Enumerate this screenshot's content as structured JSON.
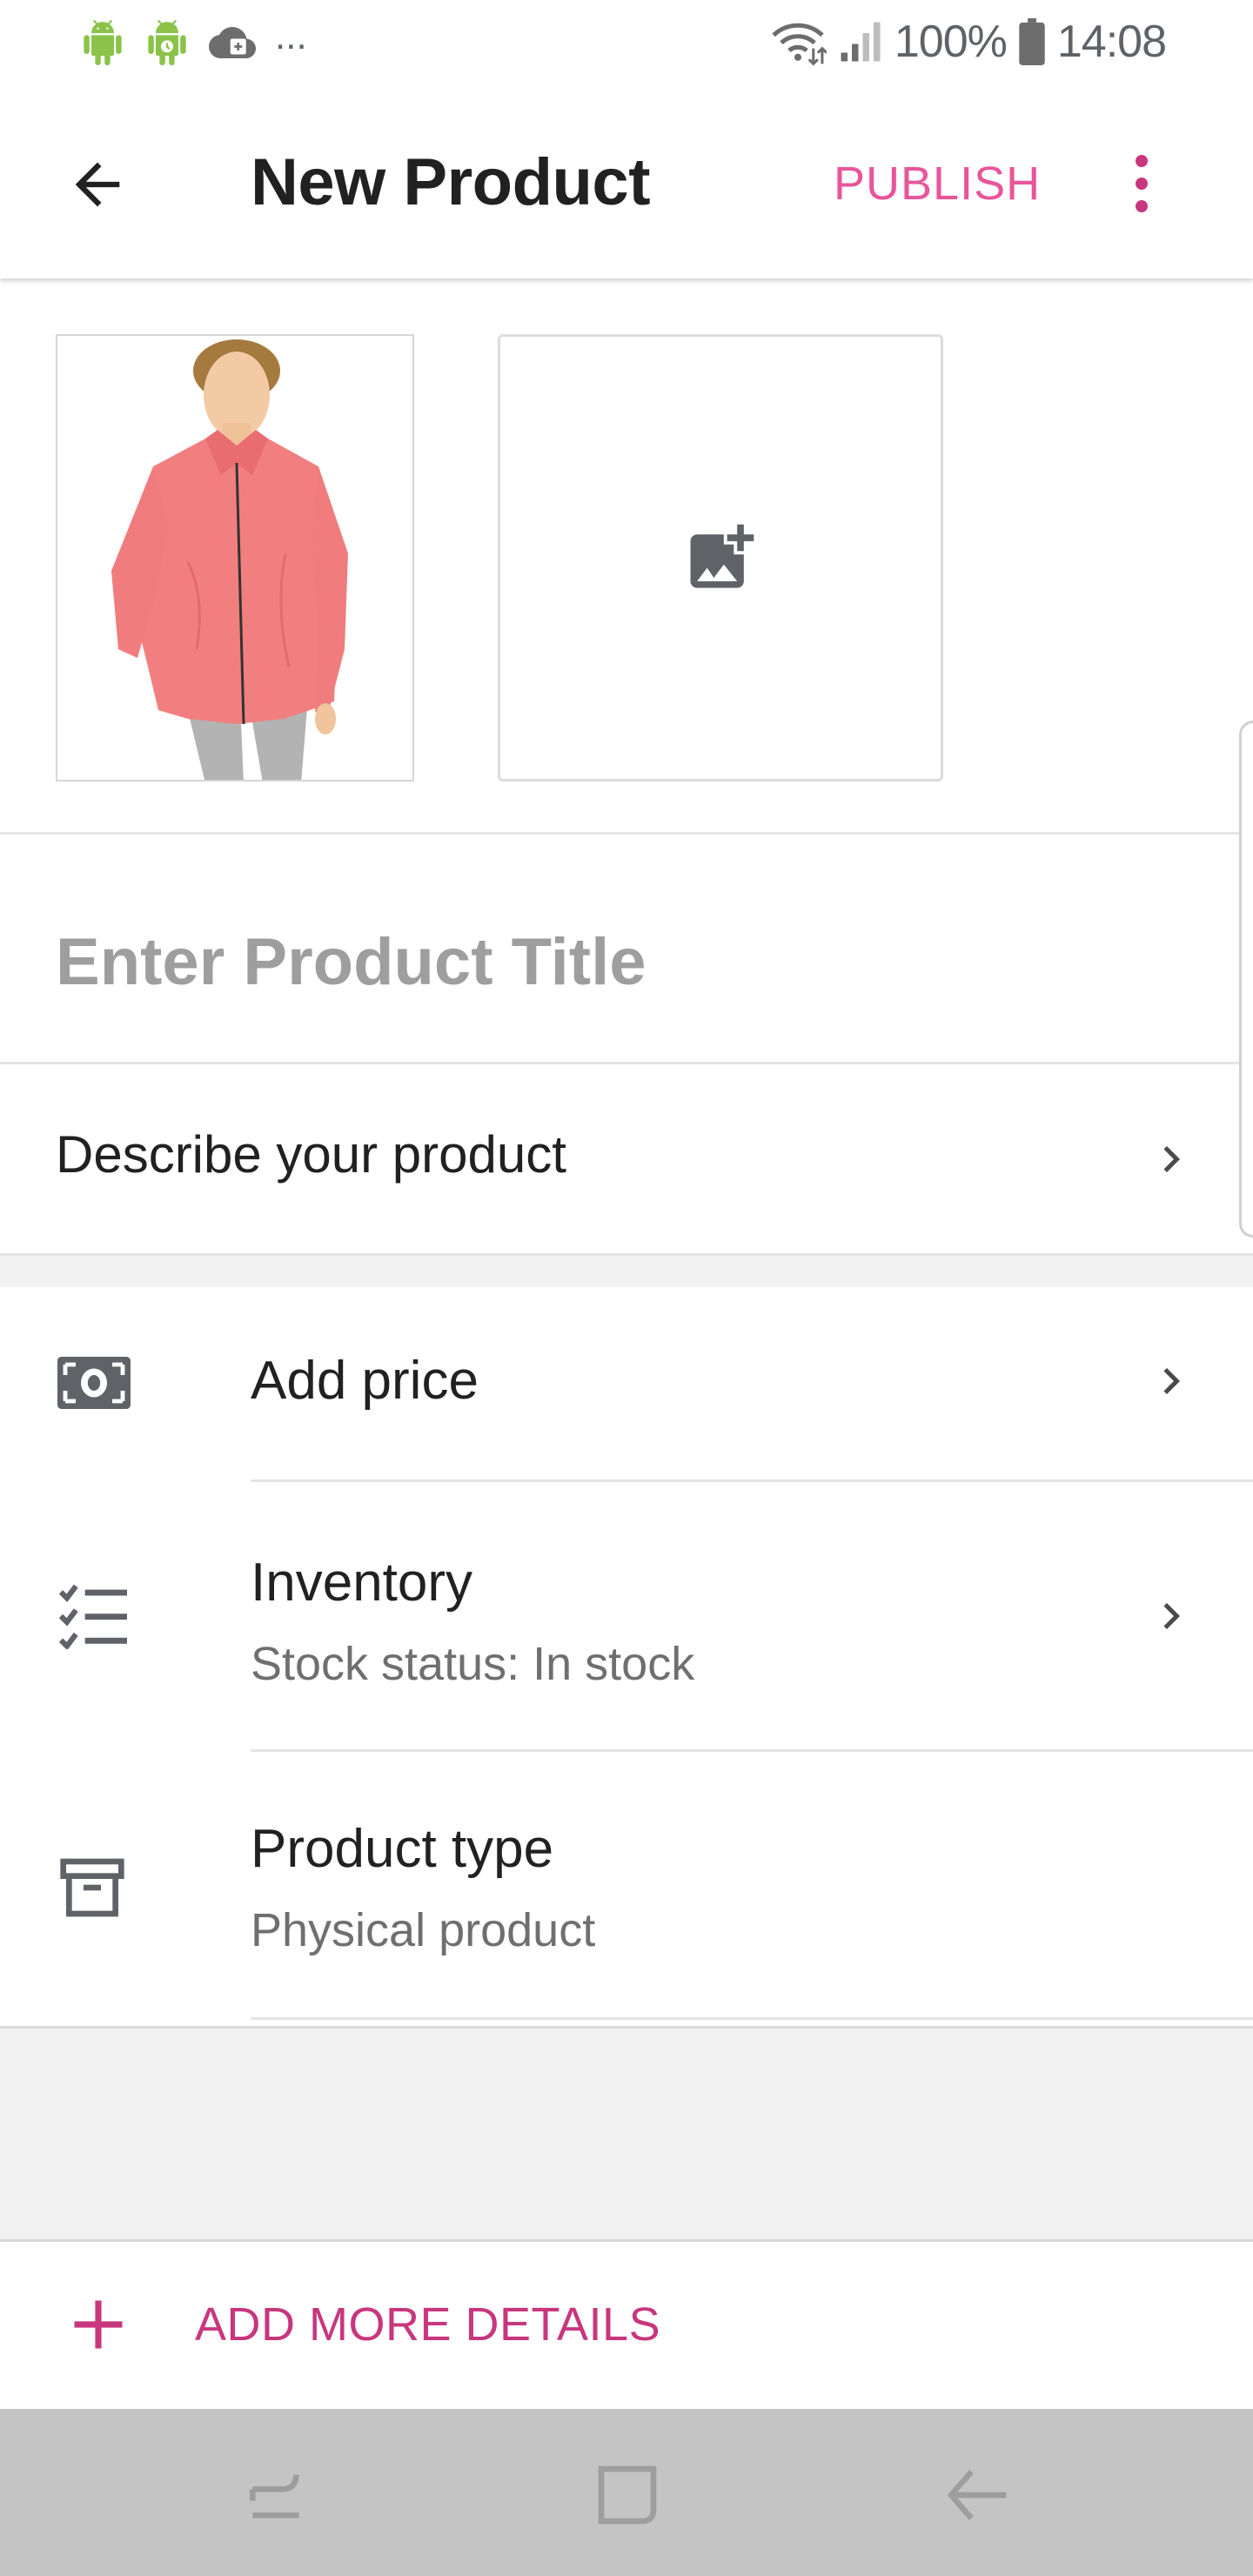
{
  "status_bar": {
    "overflow": "...",
    "battery": "100%",
    "time": "14:08"
  },
  "app_bar": {
    "title": "New Product",
    "publish_label": "PUBLISH",
    "accent_color": "#e8559a"
  },
  "photos": {
    "thumbnail_alt": "Pink zip-up jacket product photo",
    "add_photo_icon": "add-photo-icon"
  },
  "product_title": {
    "placeholder": "Enter Product Title",
    "value": ""
  },
  "description": {
    "label": "Describe your product"
  },
  "details": {
    "price": {
      "title": "Add price",
      "icon": "money-icon"
    },
    "inventory": {
      "title": "Inventory",
      "subtitle": "Stock status: In stock",
      "icon": "checklist-icon"
    },
    "product_type": {
      "title": "Product type",
      "subtitle": "Physical product",
      "icon": "archive-box-icon"
    }
  },
  "add_more": {
    "label": "ADD MORE DETAILS",
    "color": "#c8377d"
  }
}
